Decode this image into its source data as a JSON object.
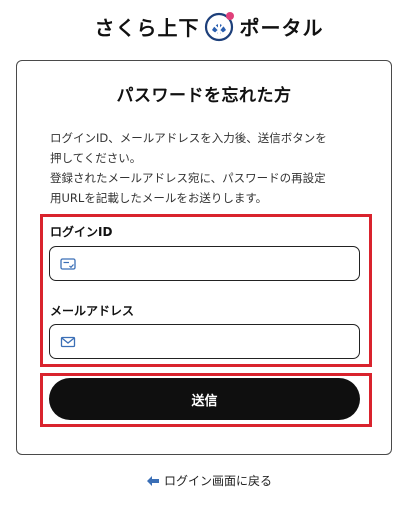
{
  "header": {
    "logo_left": "さくら上下",
    "logo_right": "ポータル"
  },
  "card": {
    "title": "パスワードを忘れた方",
    "description_lines": [
      "ログインID、メールアドレスを入力後、送信ボタンを",
      "押してください。",
      "登録されたメールアドレス宛に、パスワードの再設定",
      "用URLを記載したメールをお送りします。"
    ]
  },
  "form": {
    "login_id_label": "ログインID",
    "login_id_value": "",
    "login_id_icon": "id-card-icon",
    "email_label": "メールアドレス",
    "email_value": "",
    "email_icon": "mail-icon",
    "submit_label": "送信"
  },
  "footer": {
    "back_label": "ログイン画面に戻る",
    "back_icon": "arrow-left-icon"
  },
  "colors": {
    "highlight": "#d9232d",
    "button_bg": "#0f0f0f",
    "icon_blue": "#3b6fb6",
    "logo_blue": "#2a5fb0",
    "logo_pink": "#e0407a"
  }
}
